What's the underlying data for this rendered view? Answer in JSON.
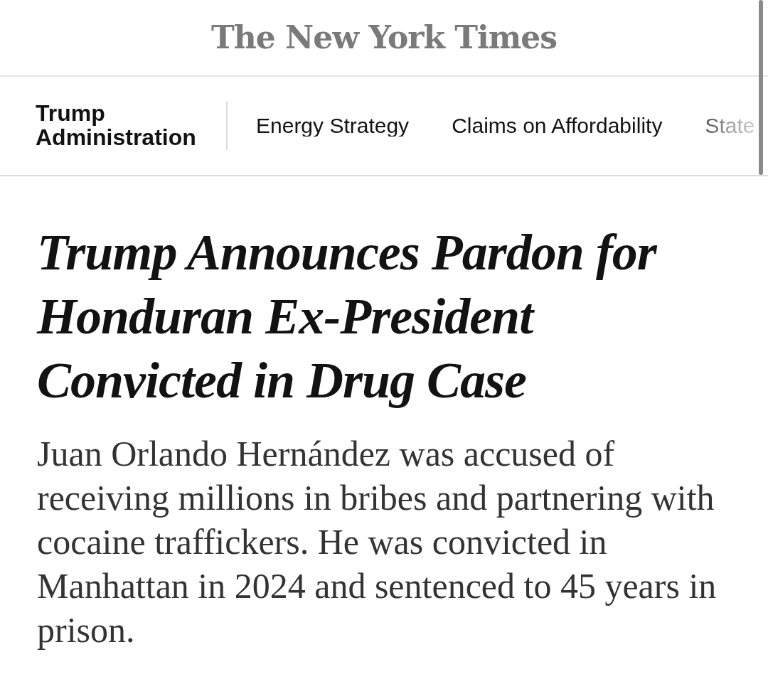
{
  "masthead": {
    "logo": "The New York Times"
  },
  "section_nav": {
    "section": "Trump Administration",
    "links": [
      {
        "label": "Energy Strategy"
      },
      {
        "label": "Claims on Affordability"
      },
      {
        "label": "State"
      }
    ]
  },
  "article": {
    "headline": "Trump Announces Pardon for Honduran Ex-President Convicted in Drug Case",
    "summary": "Juan Orlando Hernández was accused of receiving millions in bribes and partnering with cocaine traffickers. He was convicted in Manhattan in 2024 and sentenced to 45 years in prison."
  }
}
